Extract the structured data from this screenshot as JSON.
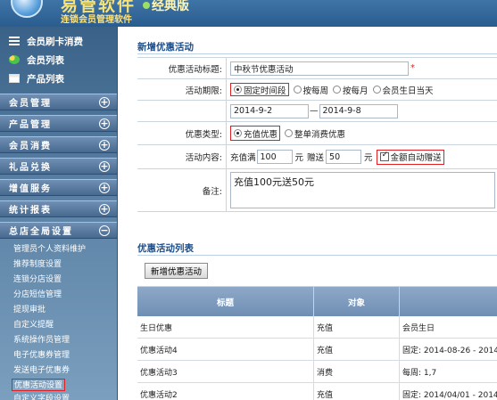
{
  "brand": {
    "title": "易管软件",
    "edition": "经典版",
    "subtitle": "连锁会员管理软件"
  },
  "sidebar": {
    "quick_links": [
      {
        "label": "会员刷卡消费",
        "icon": "card-icon"
      },
      {
        "label": "会员列表",
        "icon": "users-icon"
      },
      {
        "label": "产品列表",
        "icon": "product-icon"
      }
    ],
    "groups": [
      {
        "label": "会员管理",
        "toggle": "+"
      },
      {
        "label": "产品管理",
        "toggle": "+"
      },
      {
        "label": "会员消费",
        "toggle": "+"
      },
      {
        "label": "礼品兑换",
        "toggle": "+"
      },
      {
        "label": "增值服务",
        "toggle": "+"
      },
      {
        "label": "统计报表",
        "toggle": "+"
      },
      {
        "label": "总店全局设置",
        "toggle": "−"
      }
    ],
    "sub_items": [
      "管理员个人资料维护",
      "推荐制度设置",
      "连锁分店设置",
      "分店短信管理",
      "提现审批",
      "自定义提醒",
      "系统操作员管理",
      "电子优惠券管理",
      "发送电子优惠券",
      "优惠活动设置",
      "自定义字段设置"
    ]
  },
  "form": {
    "section_title": "新增优惠活动",
    "name_label": "优惠活动标题:",
    "name_value": "中秋节优惠活动",
    "period_label": "活动期限:",
    "period_options": [
      "固定时间段",
      "按每周",
      "按每月",
      "会员生日当天"
    ],
    "start_date": "2014-9-2",
    "date_separator": "—",
    "end_date": "2014-9-8",
    "type_label": "优惠类型:",
    "type_options": [
      "充值优惠",
      "整单消费优惠"
    ],
    "content_label": "活动内容:",
    "recharge_prefix": "充值满",
    "recharge_amount": "100",
    "unit1": "元",
    "gift_prefix": "赠送",
    "gift_amount": "50",
    "unit2": "元",
    "auto_gift_label": "金额自动赠送",
    "remark_label": "备注:",
    "remark_value": "充值100元送50元"
  },
  "list": {
    "section_title": "优惠活动列表",
    "add_button": "新增优惠活动",
    "columns": [
      "标题",
      "对象",
      ""
    ],
    "rows": [
      {
        "title": "生日优惠",
        "target": "充值",
        "rule": "会员生日"
      },
      {
        "title": "优惠活动4",
        "target": "充值",
        "rule": "固定: 2014-08-26 - 2014"
      },
      {
        "title": "优惠活动3",
        "target": "消费",
        "rule": "每周: 1,7"
      },
      {
        "title": "优惠活动2",
        "target": "充值",
        "rule": "固定: 2014/04/01 - 2014/"
      }
    ]
  }
}
